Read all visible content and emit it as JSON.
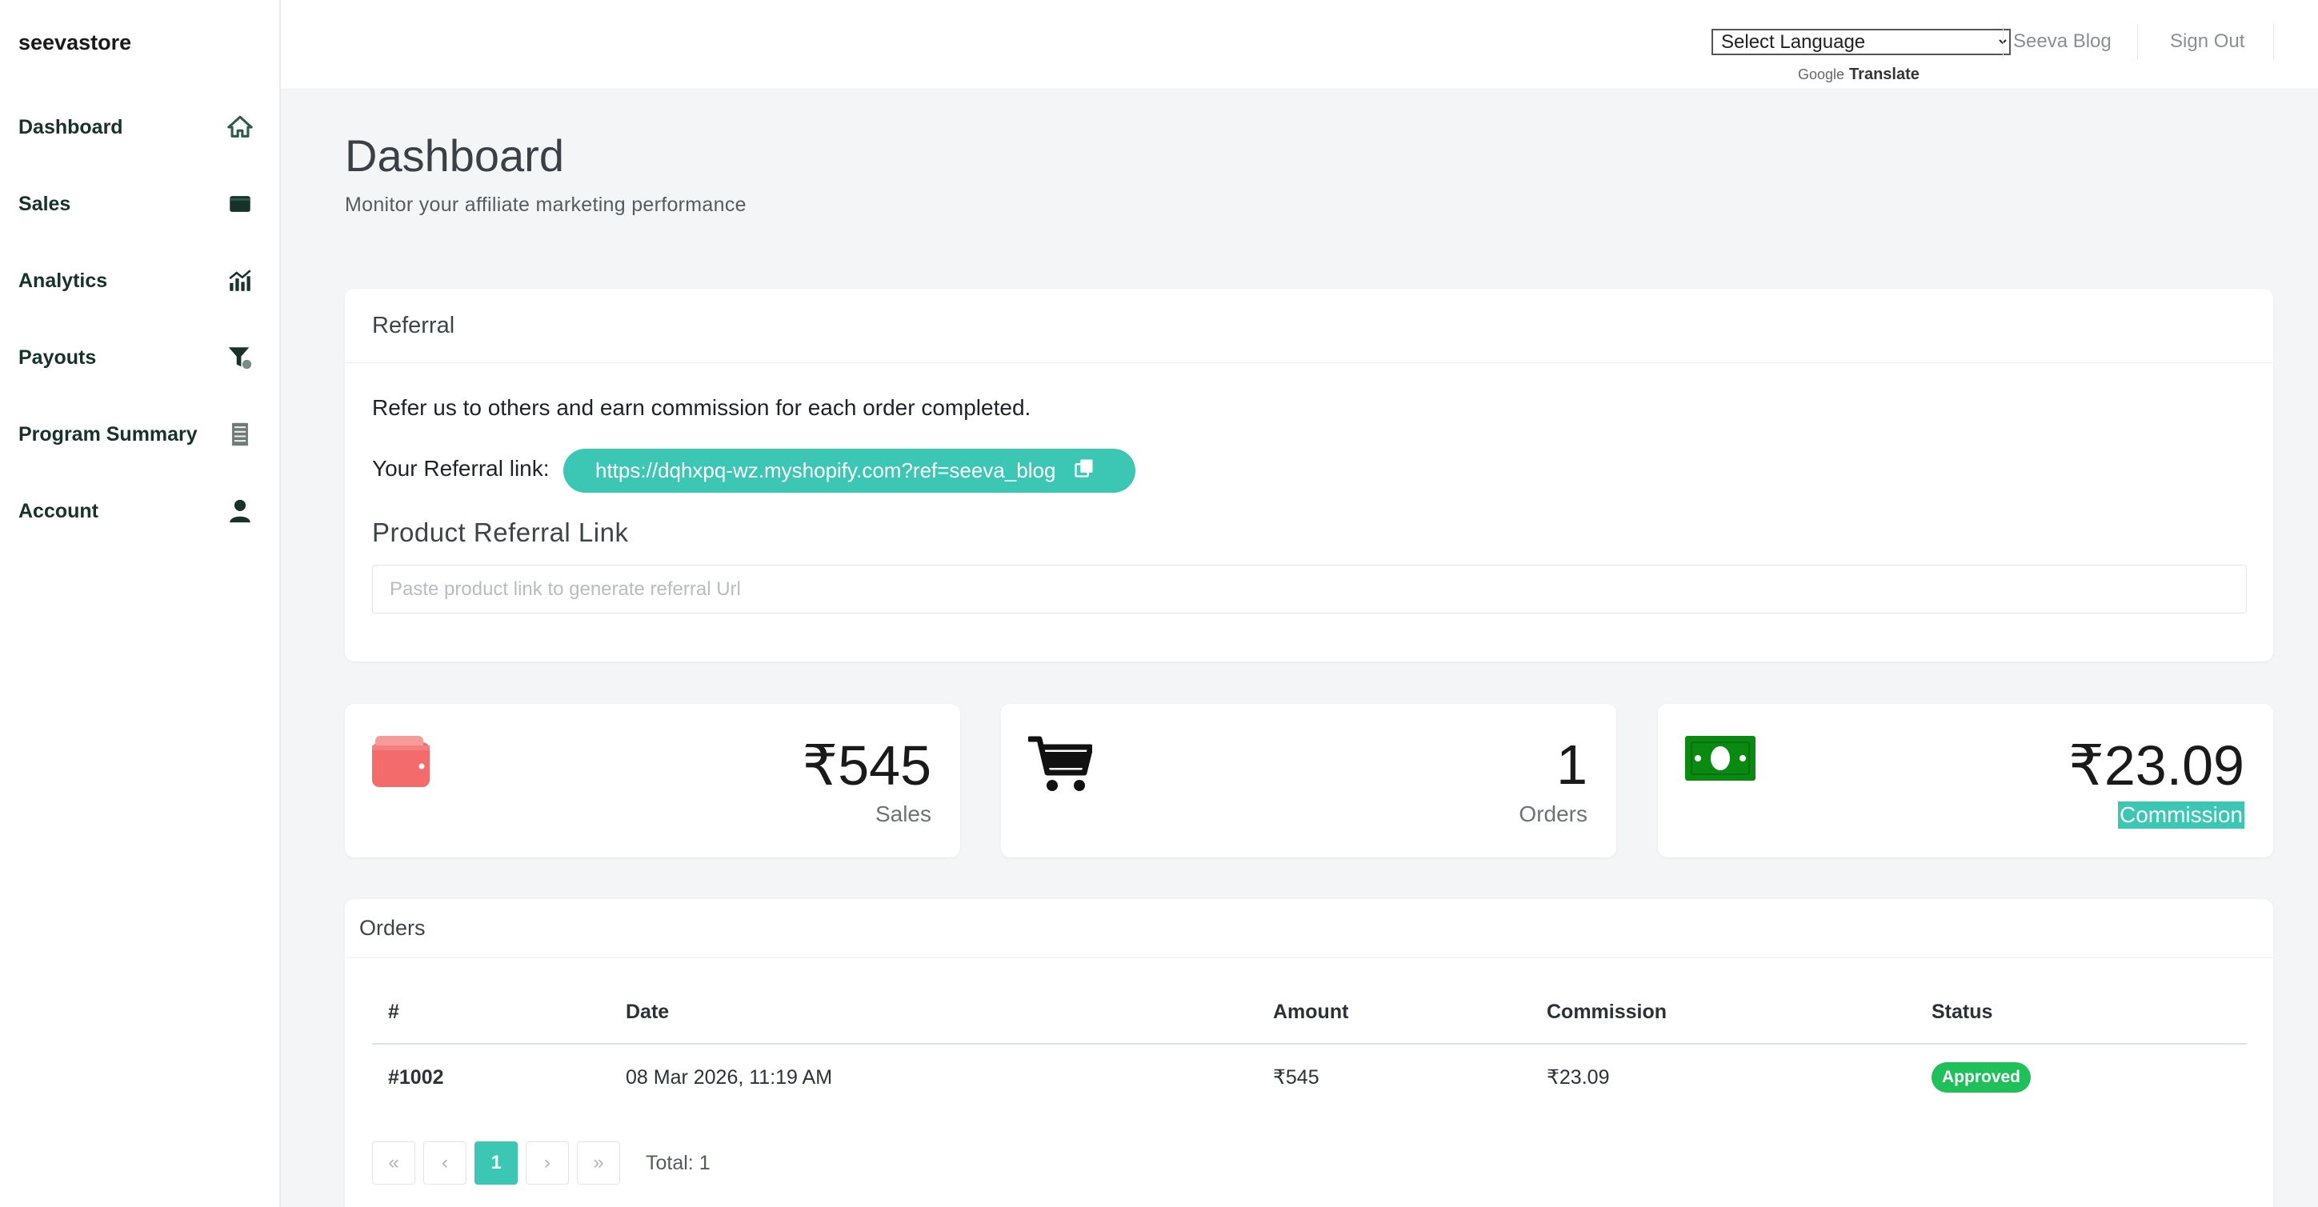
{
  "sidebar": {
    "brand": "seevastore",
    "items": [
      {
        "label": "Dashboard",
        "icon": "home-icon"
      },
      {
        "label": "Sales",
        "icon": "wallet-icon"
      },
      {
        "label": "Analytics",
        "icon": "chart-icon"
      },
      {
        "label": "Payouts",
        "icon": "filter-coin-icon"
      },
      {
        "label": "Program Summary",
        "icon": "receipt-icon"
      },
      {
        "label": "Account",
        "icon": "user-icon"
      }
    ]
  },
  "topbar": {
    "language_select": "Select Language",
    "translate_google": "Google",
    "translate_label": "Translate",
    "blog_link": "Seeva Blog",
    "signout_link": "Sign Out"
  },
  "page": {
    "title": "Dashboard",
    "subtitle": "Monitor your affiliate marketing performance"
  },
  "referral": {
    "header": "Referral",
    "description": "Refer us to others and earn commission for each order completed.",
    "link_label": "Your Referral link:",
    "link_value": "https://dqhxpq-wz.myshopify.com?ref=seeva_blog",
    "product_title": "Product Referral Link",
    "product_placeholder": "Paste product link to generate referral Url"
  },
  "stats": {
    "sales": {
      "value": "₹545",
      "label": "Sales",
      "icon_color": "#f46b6b"
    },
    "orders": {
      "value": "1",
      "label": "Orders"
    },
    "commission": {
      "value": "₹23.09",
      "label": "Commission",
      "icon_color": "#0b8a12"
    }
  },
  "orders": {
    "header": "Orders",
    "columns": [
      "#",
      "Date",
      "Amount",
      "Commission",
      "Status"
    ],
    "rows": [
      {
        "id": "#1002",
        "date": "08 Mar 2026, 11:19 AM",
        "amount": "₹545",
        "commission": "₹23.09",
        "status": "Approved"
      }
    ],
    "pagination": {
      "first": "«",
      "prev": "‹",
      "current": "1",
      "next": "›",
      "last": "»",
      "total": "Total: 1"
    }
  },
  "colors": {
    "accent": "#3cc6b4",
    "approved": "#1fbf5a",
    "sidebar_text": "#16322b"
  }
}
